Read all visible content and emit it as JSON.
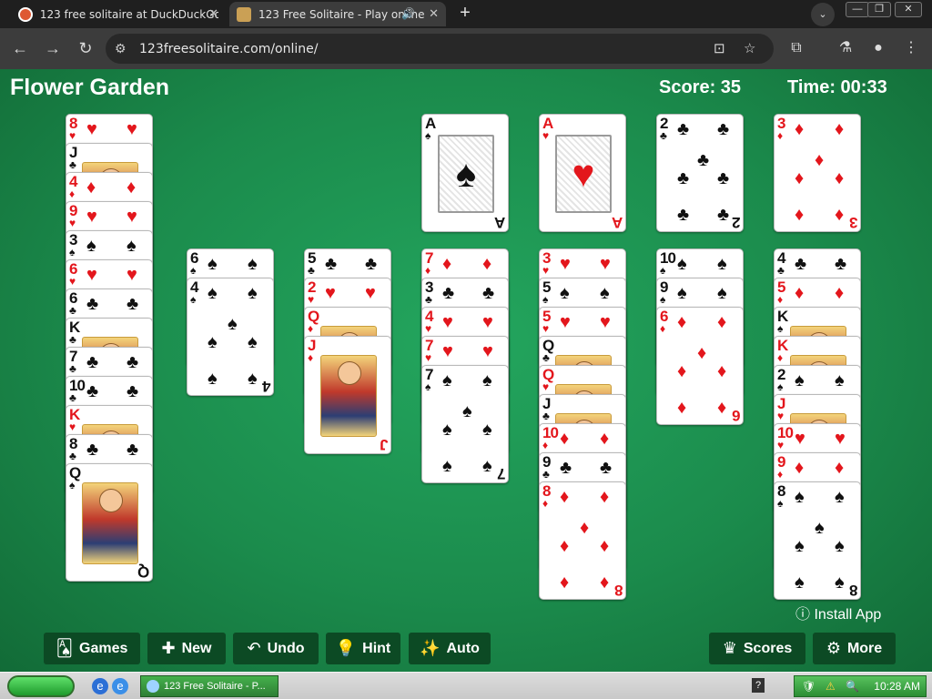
{
  "browser": {
    "tabs": [
      {
        "title": "123 free solitaire at DuckDuckGo",
        "icon": "duckduckgo-icon"
      },
      {
        "title": "123 Free Solitaire - Play online",
        "icon": "solitaire-icon"
      }
    ],
    "url": "123freesolitaire.com/online/"
  },
  "game": {
    "title": "Flower Garden",
    "score": "Score: 35",
    "time": "Time: 00:33",
    "foundations": [
      {
        "rank": "A",
        "suit": "♠",
        "color": "black"
      },
      {
        "rank": "A",
        "suit": "♥",
        "color": "red"
      },
      {
        "rank": "2",
        "suit": "♣",
        "color": "black"
      },
      {
        "rank": "3",
        "suit": "♦",
        "color": "red"
      }
    ],
    "bouquet": [
      {
        "rank": "8",
        "suit": "♥"
      },
      {
        "rank": "J",
        "suit": "♣"
      },
      {
        "rank": "4",
        "suit": "♦"
      },
      {
        "rank": "9",
        "suit": "♥"
      },
      {
        "rank": "3",
        "suit": "♠"
      },
      {
        "rank": "6",
        "suit": "♥"
      },
      {
        "rank": "6",
        "suit": "♣"
      },
      {
        "rank": "K",
        "suit": "♣"
      },
      {
        "rank": "7",
        "suit": "♣"
      },
      {
        "rank": "10",
        "suit": "♣"
      },
      {
        "rank": "K",
        "suit": "♥"
      },
      {
        "rank": "8",
        "suit": "♣"
      },
      {
        "rank": "Q",
        "suit": "♠"
      }
    ],
    "beds": [
      [
        {
          "rank": "6",
          "suit": "♠"
        },
        {
          "rank": "4",
          "suit": "♠"
        }
      ],
      [
        {
          "rank": "5",
          "suit": "♣"
        },
        {
          "rank": "2",
          "suit": "♥"
        },
        {
          "rank": "Q",
          "suit": "♦"
        },
        {
          "rank": "J",
          "suit": "♦"
        }
      ],
      [
        {
          "rank": "7",
          "suit": "♦"
        },
        {
          "rank": "3",
          "suit": "♣"
        },
        {
          "rank": "4",
          "suit": "♥"
        },
        {
          "rank": "7",
          "suit": "♥"
        },
        {
          "rank": "7",
          "suit": "♠"
        }
      ],
      [
        {
          "rank": "3",
          "suit": "♥"
        },
        {
          "rank": "5",
          "suit": "♠"
        },
        {
          "rank": "5",
          "suit": "♥"
        },
        {
          "rank": "Q",
          "suit": "♣"
        },
        {
          "rank": "Q",
          "suit": "♥"
        },
        {
          "rank": "J",
          "suit": "♣"
        },
        {
          "rank": "10",
          "suit": "♦"
        },
        {
          "rank": "9",
          "suit": "♣"
        },
        {
          "rank": "8",
          "suit": "♦"
        }
      ],
      [
        {
          "rank": "10",
          "suit": "♠"
        },
        {
          "rank": "9",
          "suit": "♠"
        },
        {
          "rank": "6",
          "suit": "♦"
        }
      ],
      [
        {
          "rank": "4",
          "suit": "♣"
        },
        {
          "rank": "5",
          "suit": "♦"
        },
        {
          "rank": "K",
          "suit": "♠"
        },
        {
          "rank": "K",
          "suit": "♦"
        },
        {
          "rank": "2",
          "suit": "♠"
        },
        {
          "rank": "J",
          "suit": "♥"
        },
        {
          "rank": "10",
          "suit": "♥"
        },
        {
          "rank": "9",
          "suit": "♦"
        },
        {
          "rank": "8",
          "suit": "♠"
        }
      ]
    ],
    "install_label": "Install App",
    "buttons": {
      "games": "Games",
      "new": "New",
      "undo": "Undo",
      "hint": "Hint",
      "auto": "Auto",
      "scores": "Scores",
      "more": "More"
    }
  },
  "taskbar": {
    "task_label": "123 Free Solitaire - P...",
    "clock": "10:28 AM"
  }
}
